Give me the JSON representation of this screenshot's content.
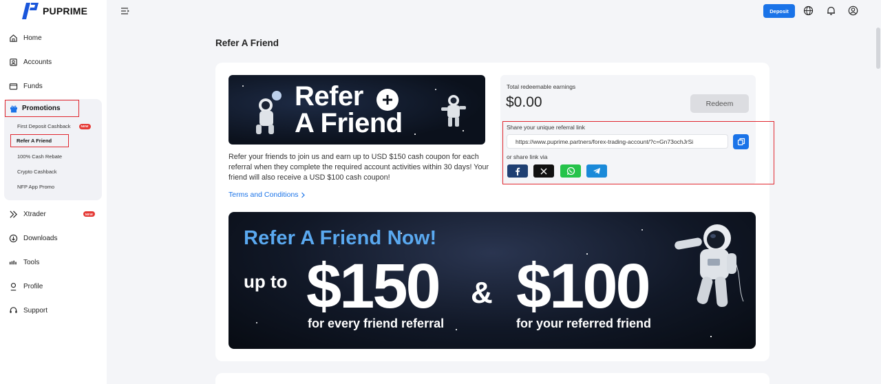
{
  "brand": {
    "name": "PUPRIME"
  },
  "header": {
    "deposit_label": "Deposit"
  },
  "sidebar": {
    "items": [
      {
        "label": "Home",
        "icon": "home-icon"
      },
      {
        "label": "Accounts",
        "icon": "accounts-icon"
      },
      {
        "label": "Funds",
        "icon": "wallet-icon"
      },
      {
        "label": "Promotions",
        "icon": "gift-icon"
      },
      {
        "label": "Xtrader",
        "icon": "xtrader-icon",
        "badge": "NEW"
      },
      {
        "label": "Downloads",
        "icon": "download-icon"
      },
      {
        "label": "Tools",
        "icon": "tools-icon"
      },
      {
        "label": "Profile",
        "icon": "profile-icon"
      },
      {
        "label": "Support",
        "icon": "support-icon"
      }
    ],
    "promotions": [
      {
        "label": "First Deposit Cashback",
        "badge": "NEW"
      },
      {
        "label": "Refer A Friend"
      },
      {
        "label": "100% Cash Rebate"
      },
      {
        "label": "Crypto Cashback"
      },
      {
        "label": "NFP App Promo"
      }
    ]
  },
  "page": {
    "title": "Refer A Friend"
  },
  "hero": {
    "line1": "Refer",
    "line2": "A Friend"
  },
  "description": "Refer your friends to join us and earn up to USD $150 cash coupon for each referral when they complete the required account activities within 30 days! Your friend will also receive a USD $100 cash coupon!",
  "terms_label": "Terms and Conditions",
  "earnings": {
    "label": "Total redeemable earnings",
    "value": "$0.00",
    "redeem_label": "Redeem"
  },
  "referral": {
    "share_label": "Share your unique referral link",
    "link": "https://www.puprime.partners/forex-trading-account/?c=Gn73ochJrSi",
    "via_label": "or share link via",
    "socials": [
      "facebook",
      "x",
      "whatsapp",
      "telegram"
    ]
  },
  "banner": {
    "title": "Refer A Friend Now!",
    "up_to": "up to",
    "amount_referrer": "$150",
    "amp": "&",
    "amount_friend": "$100",
    "sub_referrer": "for every friend referral",
    "sub_friend": "for your referred friend"
  },
  "colors": {
    "accent": "#1a73e8",
    "highlight": "#e0262e",
    "banner_title": "#5aa9f0"
  }
}
